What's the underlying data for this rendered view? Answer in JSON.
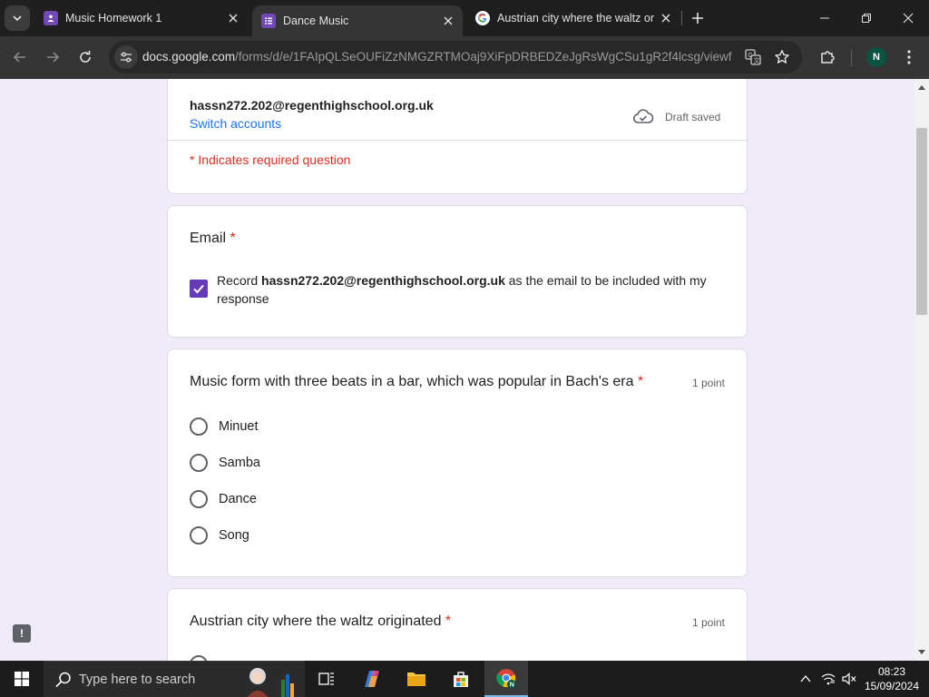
{
  "browser": {
    "tabs": [
      {
        "title": "Music Homework 1",
        "favicon": "forms-purple-icon"
      },
      {
        "title": "Dance Music",
        "favicon": "forms-purple-icon",
        "active": true
      },
      {
        "title": "Austrian city where the waltz or",
        "favicon": "google-g-icon"
      }
    ],
    "url_host": "docs.google.com",
    "url_path": "/forms/d/e/1FAIpQLSeOUFiZzNMGZRTMOaj9XiFpDRBEDZeJgRsWgCSu1gR2f4lcsg/viewf...",
    "profile_initial": "N"
  },
  "form": {
    "account_email": "hassn272.202@regenthighschool.org.uk",
    "switch_accounts": "Switch accounts",
    "draft_status": "Draft saved",
    "required_note": "* Indicates required question",
    "email_question": {
      "title": "Email",
      "required_mark": "*",
      "record_prefix": "Record ",
      "record_email": "hassn272.202@regenthighschool.org.uk",
      "record_suffix": " as the email to be included with my response",
      "checked": true
    },
    "question1": {
      "title": "Music form with three beats in a bar, which was popular in Bach's era",
      "required_mark": "*",
      "points": "1 point",
      "options": [
        "Minuet",
        "Samba",
        "Dance",
        "Song"
      ]
    },
    "question2": {
      "title": "Austrian city where the waltz originated",
      "required_mark": "*",
      "points": "1 point"
    }
  },
  "taskbar": {
    "search_placeholder": "Type here to search",
    "time": "08:23",
    "date": "15/09/2024"
  },
  "colors": {
    "accent": "#673ab7",
    "page_bg": "#f0ebf8",
    "required": "#d93025",
    "link": "#1a73e8"
  }
}
